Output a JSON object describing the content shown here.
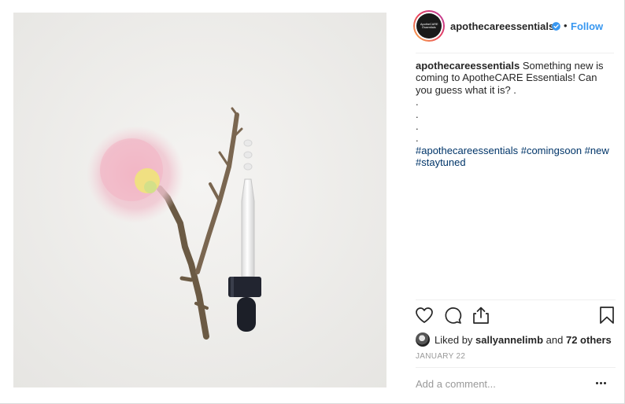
{
  "post": {
    "account": {
      "username": "apothecareessentials",
      "avatar_text": "ApotheCARE Essentials",
      "verified_icon": "verified-badge-icon",
      "separator": "•",
      "follow_label": "Follow"
    },
    "caption": {
      "username": "apothecareessentials",
      "text": "Something new is coming to ApotheCARE Essentials! Can you guess what it is? .",
      "dot_lines": [
        ".",
        ".",
        ".",
        "."
      ],
      "hashtags": [
        "#apothecareessentials",
        "#comingsoon",
        "#new",
        "#staytuned"
      ]
    },
    "actions": {
      "like_icon": "heart-icon",
      "comment_icon": "comment-bubble-icon",
      "share_icon": "share-icon",
      "save_icon": "bookmark-icon"
    },
    "likes": {
      "prefix": "Liked by",
      "user": "sallyannelimb",
      "conjunction": "and",
      "others": "72 others"
    },
    "date": "JANUARY 22",
    "comment": {
      "placeholder": "Add a comment...",
      "more_icon": "more-options-icon"
    }
  },
  "colors": {
    "link_blue": "#3897f0",
    "hashtag_blue": "#003569",
    "text": "#262626",
    "muted": "#999999"
  }
}
